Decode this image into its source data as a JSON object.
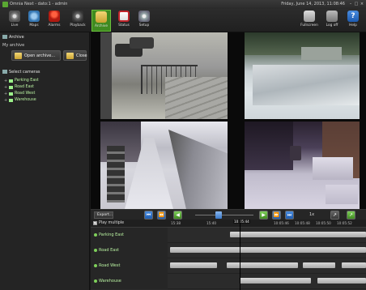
{
  "window": {
    "title": "Omnia Next - dato:1 - admin",
    "datetime": "Friday, June 14, 2013, 11:08:46",
    "min": "–",
    "max": "□",
    "close": "×"
  },
  "toolbar": {
    "items": [
      {
        "label": "Live",
        "icon": "live-icon"
      },
      {
        "label": "Maps",
        "icon": "globe-icon"
      },
      {
        "label": "Alarms",
        "icon": "alarm-icon"
      },
      {
        "label": "Playback",
        "icon": "playback-icon"
      },
      {
        "label": "Archive",
        "icon": "archive-icon",
        "active": true
      },
      {
        "label": "Status",
        "icon": "status-icon"
      },
      {
        "label": "Setup",
        "icon": "gear-icon"
      }
    ],
    "right_items": [
      {
        "label": "Fullscreen",
        "icon": "fullscreen-icon"
      },
      {
        "label": "Log off",
        "icon": "logoff-icon"
      },
      {
        "label": "Help",
        "icon": "help-icon",
        "glyph": "?"
      }
    ]
  },
  "sidebar": {
    "archive_header": "Archive",
    "my_archive": "My archive",
    "open_archive_label": "Open archive...",
    "close_label": "Close",
    "select_cameras_header": "Select cameras",
    "cameras": [
      {
        "name": "Parking East"
      },
      {
        "name": "Road East"
      },
      {
        "name": "Road West"
      },
      {
        "name": "Warehouse"
      }
    ]
  },
  "controls": {
    "export_label": "Export...",
    "speed": "1x",
    "speed_position": 0.4
  },
  "timeline": {
    "play_multiple_label": "Play multiple",
    "play_multiple_checked": true,
    "ticks": [
      "15:38",
      "15:40",
      "10:05:46",
      "10:05:48",
      "10:05:50",
      "10:05:52"
    ],
    "cursor_time": "10:05:44",
    "tracks": [
      {
        "name": "Parking East"
      },
      {
        "name": "Road East"
      },
      {
        "name": "Road West"
      },
      {
        "name": "Warehouse"
      }
    ]
  },
  "colors": {
    "accent_green": "#5aa832",
    "active_tab": "#3f8a20",
    "camera_label": "#b8f0a0",
    "control_blue": "#1d5bb0"
  }
}
